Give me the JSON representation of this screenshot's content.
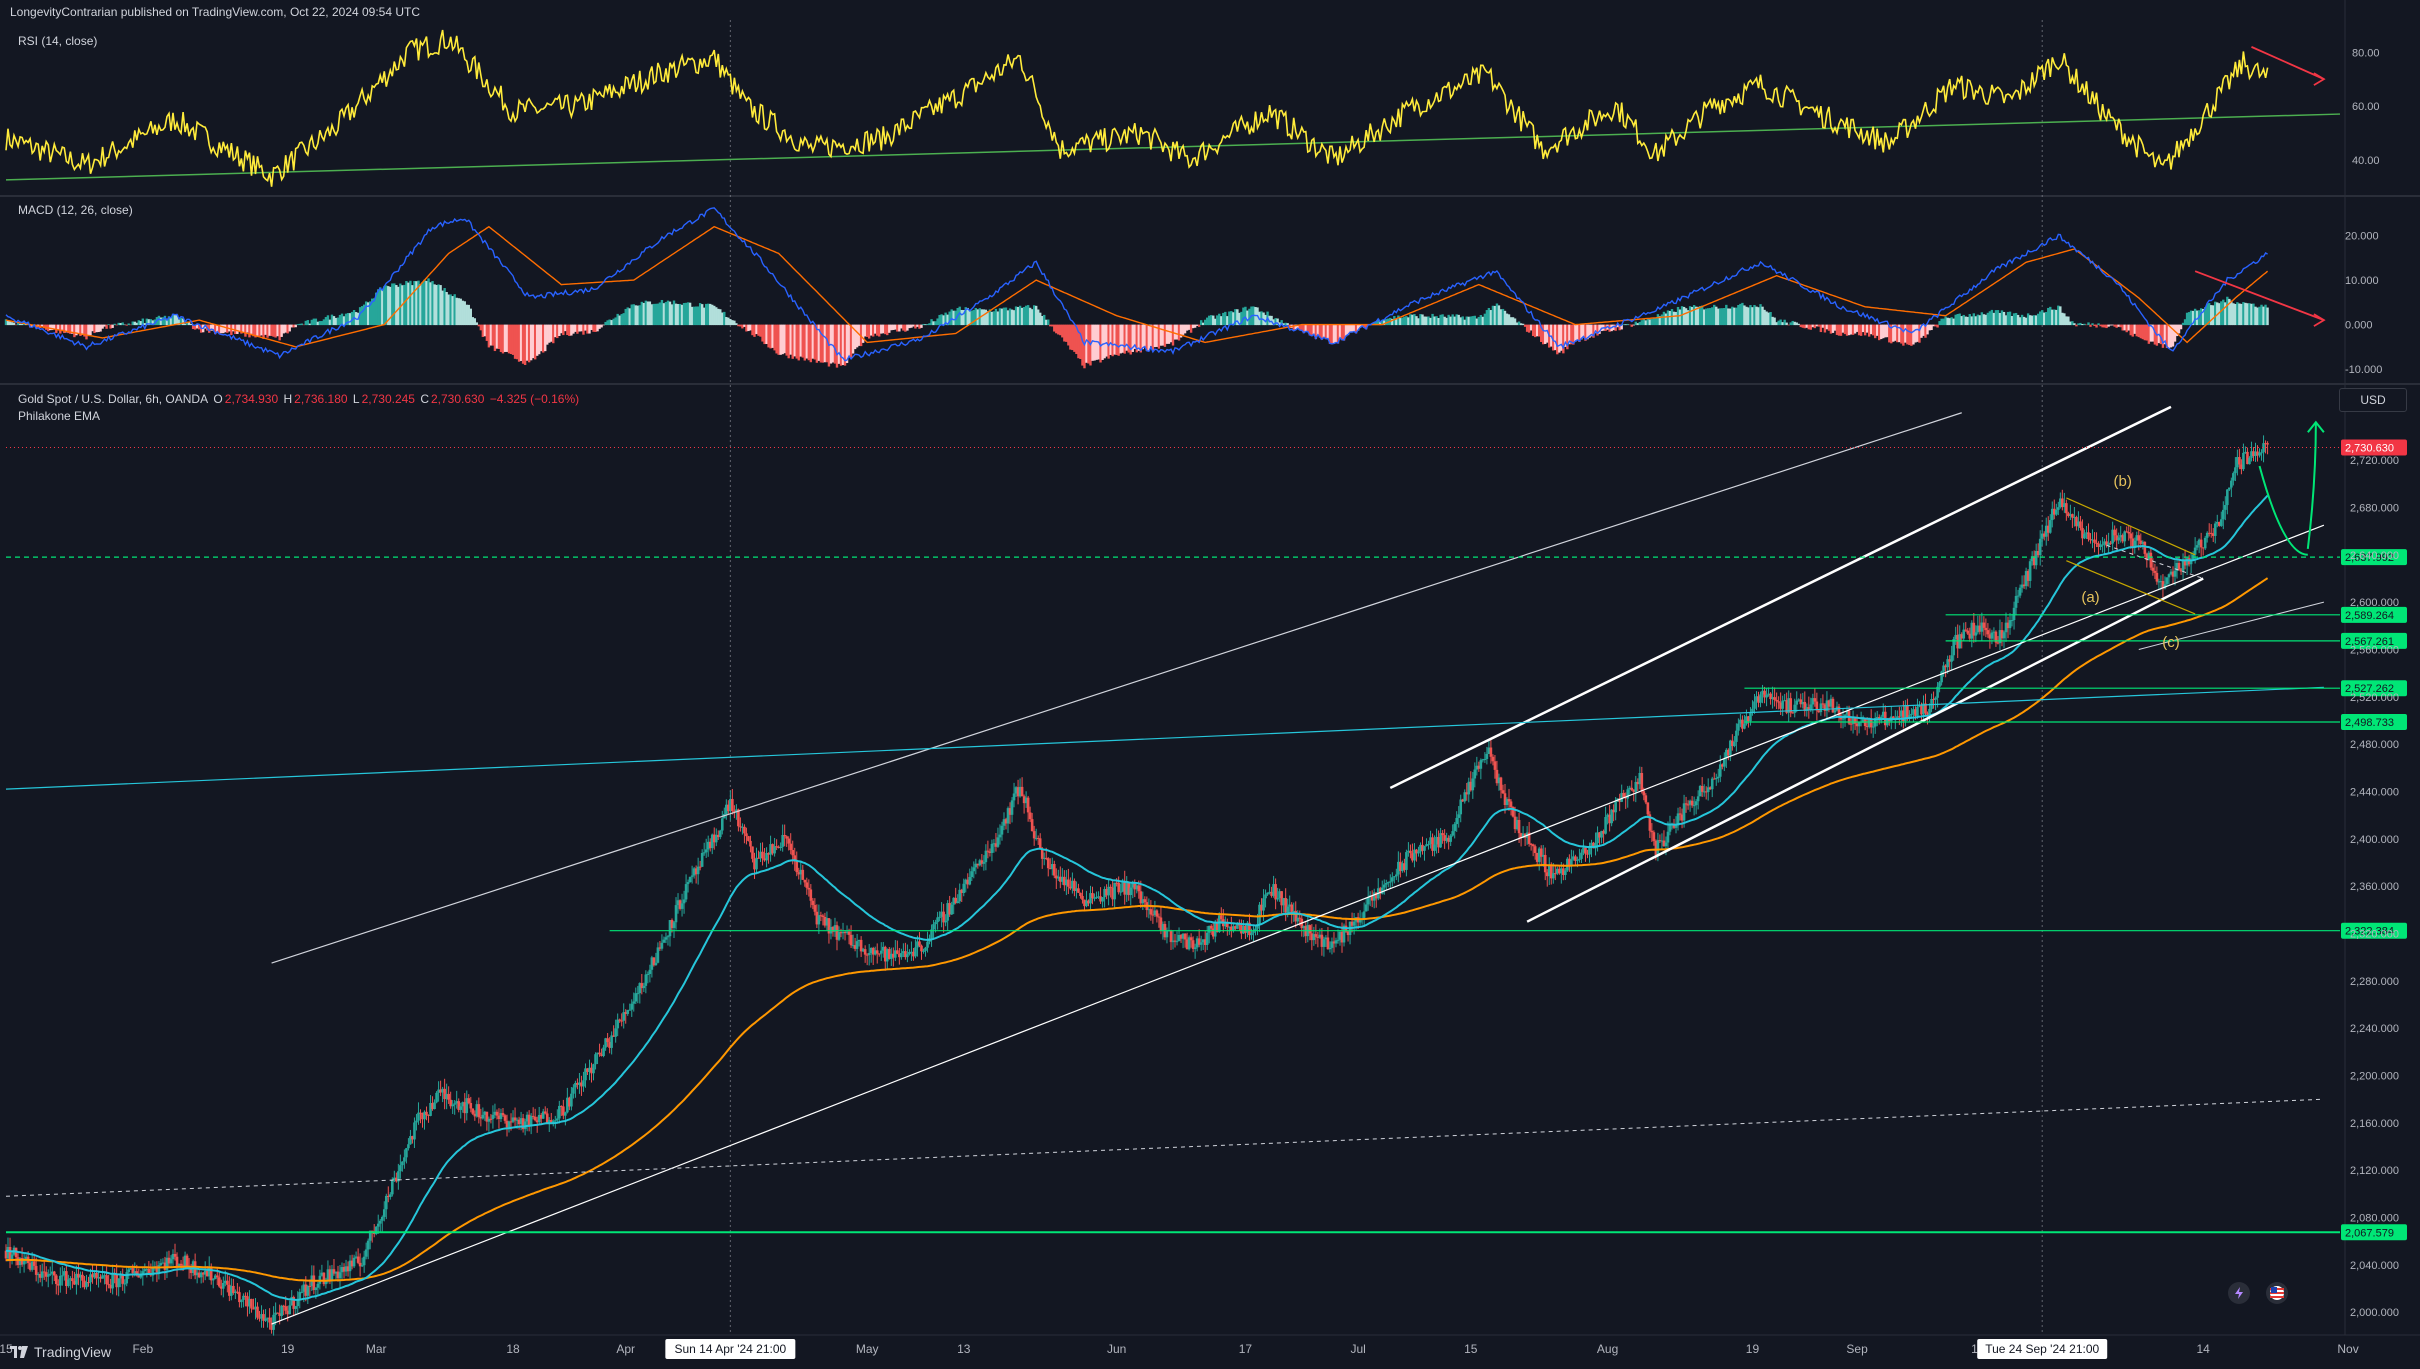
{
  "header": {
    "published": "LongevityContrarian published on TradingView.com, Oct 22, 2024 09:54 UTC"
  },
  "panes": {
    "rsi": {
      "title": "RSI (14, close)",
      "ticks": [
        "80.00",
        "60.00",
        "40.00"
      ]
    },
    "macd": {
      "title": "MACD (12, 26, close)",
      "ticks": [
        "20.000",
        "10.000",
        "0.000",
        "-10.000"
      ]
    },
    "price": {
      "symbol": "Gold Spot / U.S. Dollar, 6h, OANDA",
      "open_label": "O",
      "open": "2,734.930",
      "high_label": "H",
      "high": "2,736.180",
      "low_label": "L",
      "low": "2,730.245",
      "close_label": "C",
      "close": "2,730.630",
      "change": "−4.325 (−0.16%)",
      "indicator": "Philakone EMA",
      "currency": "USD"
    }
  },
  "footer": {
    "brand": "TradingView"
  },
  "icons": [
    "tradingview-logo-icon",
    "lightning-icon",
    "us-flag-icon"
  ],
  "colors": {
    "background": "#131722",
    "rsi_line": "#ffeb3b",
    "macd_line": "#2962ff",
    "signal_line": "#ff6d00",
    "ema_fast": "#26c6da",
    "ema_slow": "#ff9800",
    "support_green": "#00e676",
    "bull_candle": "#26a69a",
    "bear_candle": "#ef5350"
  },
  "chart_data": {
    "type": "candlestick",
    "title": "Gold Spot / U.S. Dollar, 6h, OANDA",
    "x_range": [
      "2024-01-15",
      "2024-10-31"
    ],
    "x_ticks": [
      "15",
      "Feb",
      "19",
      "Mar",
      "18",
      "Apr",
      "May",
      "13",
      "Jun",
      "17",
      "Jul",
      "15",
      "Aug",
      "19",
      "Sep",
      "16",
      "14",
      "Nov"
    ],
    "crosshair_labels": [
      "Sun 14 Apr '24   21:00",
      "Tue 24 Sep '24   21:00"
    ],
    "crosshair_x": [
      "2024-04-14",
      "2024-09-24"
    ],
    "y_range": [
      1985,
      2775
    ],
    "y_ticks": [
      2000,
      2040,
      2080,
      2120,
      2160,
      2200,
      2240,
      2280,
      2320,
      2360,
      2400,
      2440,
      2480,
      2520,
      2560,
      2600,
      2640,
      2680,
      2720
    ],
    "last_price": {
      "value": 2730.63,
      "label": "2,730.630"
    },
    "price_path": [
      [
        "2024-01-15",
        2052
      ],
      [
        "2024-01-20",
        2030
      ],
      [
        "2024-01-28",
        2025
      ],
      [
        "2024-02-05",
        2045
      ],
      [
        "2024-02-10",
        2030
      ],
      [
        "2024-02-17",
        1990
      ],
      [
        "2024-02-22",
        2025
      ],
      [
        "2024-02-28",
        2042
      ],
      [
        "2024-03-02",
        2090
      ],
      [
        "2024-03-06",
        2160
      ],
      [
        "2024-03-09",
        2185
      ],
      [
        "2024-03-15",
        2165
      ],
      [
        "2024-03-20",
        2160
      ],
      [
        "2024-03-24",
        2170
      ],
      [
        "2024-03-30",
        2230
      ],
      [
        "2024-04-04",
        2290
      ],
      [
        "2024-04-08",
        2350
      ],
      [
        "2024-04-12",
        2400
      ],
      [
        "2024-04-14",
        2432
      ],
      [
        "2024-04-17",
        2380
      ],
      [
        "2024-04-21",
        2400
      ],
      [
        "2024-04-25",
        2330
      ],
      [
        "2024-04-30",
        2310
      ],
      [
        "2024-05-04",
        2300
      ],
      [
        "2024-05-08",
        2310
      ],
      [
        "2024-05-13",
        2360
      ],
      [
        "2024-05-17",
        2400
      ],
      [
        "2024-05-20",
        2445
      ],
      [
        "2024-05-23",
        2380
      ],
      [
        "2024-05-28",
        2350
      ],
      [
        "2024-06-03",
        2360
      ],
      [
        "2024-06-07",
        2320
      ],
      [
        "2024-06-11",
        2310
      ],
      [
        "2024-06-14",
        2330
      ],
      [
        "2024-06-18",
        2325
      ],
      [
        "2024-06-20",
        2360
      ],
      [
        "2024-06-25",
        2320
      ],
      [
        "2024-06-28",
        2310
      ],
      [
        "2024-07-03",
        2350
      ],
      [
        "2024-07-08",
        2390
      ],
      [
        "2024-07-12",
        2400
      ],
      [
        "2024-07-16",
        2460
      ],
      [
        "2024-07-17",
        2475
      ],
      [
        "2024-07-20",
        2420
      ],
      [
        "2024-07-25",
        2370
      ],
      [
        "2024-07-30",
        2390
      ],
      [
        "2024-08-02",
        2430
      ],
      [
        "2024-08-05",
        2450
      ],
      [
        "2024-08-07",
        2390
      ],
      [
        "2024-08-10",
        2420
      ],
      [
        "2024-08-14",
        2450
      ],
      [
        "2024-08-18",
        2500
      ],
      [
        "2024-08-20",
        2525
      ],
      [
        "2024-08-24",
        2510
      ],
      [
        "2024-08-28",
        2515
      ],
      [
        "2024-09-02",
        2495
      ],
      [
        "2024-09-06",
        2505
      ],
      [
        "2024-09-10",
        2510
      ],
      [
        "2024-09-13",
        2565
      ],
      [
        "2024-09-16",
        2580
      ],
      [
        "2024-09-19",
        2570
      ],
      [
        "2024-09-22",
        2620
      ],
      [
        "2024-09-26",
        2685
      ],
      [
        "2024-09-30",
        2650
      ],
      [
        "2024-10-03",
        2655
      ],
      [
        "2024-10-06",
        2650
      ],
      [
        "2024-10-09",
        2615
      ],
      [
        "2024-10-11",
        2630
      ],
      [
        "2024-10-14",
        2650
      ],
      [
        "2024-10-16",
        2670
      ],
      [
        "2024-10-18",
        2715
      ],
      [
        "2024-10-21",
        2732
      ],
      [
        "2024-10-22",
        2730
      ]
    ],
    "series": [
      {
        "name": "Philakone EMA",
        "color": "#26c6da"
      },
      {
        "name": "Philakone EMA",
        "color": "#ff9800"
      }
    ],
    "horizontal_levels": [
      {
        "value": 2637.992,
        "label": "2,637.992",
        "style": "dashed"
      },
      {
        "value": 2589.264,
        "label": "2,589.264",
        "style": "solid"
      },
      {
        "value": 2567.261,
        "label": "2,567.261",
        "style": "solid"
      },
      {
        "value": 2527.262,
        "label": "2,527.262",
        "style": "solid"
      },
      {
        "value": 2498.733,
        "label": "2,498.733",
        "style": "solid"
      },
      {
        "value": 2322.384,
        "label": "2,322.384",
        "style": "solid"
      },
      {
        "value": 2067.579,
        "label": "2,067.579",
        "style": "solid"
      }
    ],
    "wave_labels": [
      "(a)",
      "(b)",
      "(c)"
    ],
    "rsi": {
      "y_range": [
        28,
        92
      ],
      "ticks": [
        80,
        60,
        40
      ],
      "path": [
        [
          "2024-01-15",
          48
        ],
        [
          "2024-01-25",
          38
        ],
        [
          "2024-02-05",
          55
        ],
        [
          "2024-02-17",
          34
        ],
        [
          "2024-02-25",
          52
        ],
        [
          "2024-03-05",
          80
        ],
        [
          "2024-03-10",
          85
        ],
        [
          "2024-03-18",
          58
        ],
        [
          "2024-03-26",
          60
        ],
        [
          "2024-04-05",
          72
        ],
        [
          "2024-04-12",
          78
        ],
        [
          "2024-04-16",
          60
        ],
        [
          "2024-04-24",
          44
        ],
        [
          "2024-05-03",
          48
        ],
        [
          "2024-05-13",
          65
        ],
        [
          "2024-05-20",
          78
        ],
        [
          "2024-05-25",
          44
        ],
        [
          "2024-06-04",
          50
        ],
        [
          "2024-06-10",
          40
        ],
        [
          "2024-06-20",
          58
        ],
        [
          "2024-06-28",
          40
        ],
        [
          "2024-07-08",
          60
        ],
        [
          "2024-07-17",
          72
        ],
        [
          "2024-07-24",
          44
        ],
        [
          "2024-08-02",
          60
        ],
        [
          "2024-08-07",
          42
        ],
        [
          "2024-08-14",
          60
        ],
        [
          "2024-08-20",
          68
        ],
        [
          "2024-08-28",
          56
        ],
        [
          "2024-09-05",
          46
        ],
        [
          "2024-09-13",
          68
        ],
        [
          "2024-09-20",
          62
        ],
        [
          "2024-09-26",
          78
        ],
        [
          "2024-10-02",
          56
        ],
        [
          "2024-10-09",
          36
        ],
        [
          "2024-10-15",
          60
        ],
        [
          "2024-10-19",
          76
        ],
        [
          "2024-10-22",
          70
        ]
      ]
    },
    "macd": {
      "y_range": [
        -12,
        28
      ],
      "ticks": [
        20,
        10,
        0,
        -10
      ],
      "macd_path": [
        [
          "2024-01-15",
          2
        ],
        [
          "2024-01-25",
          -5
        ],
        [
          "2024-02-05",
          2
        ],
        [
          "2024-02-18",
          -7
        ],
        [
          "2024-02-28",
          2
        ],
        [
          "2024-03-08",
          22
        ],
        [
          "2024-03-12",
          24
        ],
        [
          "2024-03-20",
          6
        ],
        [
          "2024-03-28",
          8
        ],
        [
          "2024-04-06",
          20
        ],
        [
          "2024-04-12",
          26
        ],
        [
          "2024-04-18",
          14
        ],
        [
          "2024-04-28",
          -8
        ],
        [
          "2024-05-08",
          -3
        ],
        [
          "2024-05-16",
          6
        ],
        [
          "2024-05-22",
          14
        ],
        [
          "2024-05-28",
          -4
        ],
        [
          "2024-06-08",
          -6
        ],
        [
          "2024-06-18",
          2
        ],
        [
          "2024-06-28",
          -4
        ],
        [
          "2024-07-08",
          5
        ],
        [
          "2024-07-18",
          12
        ],
        [
          "2024-07-26",
          -5
        ],
        [
          "2024-08-08",
          4
        ],
        [
          "2024-08-20",
          14
        ],
        [
          "2024-08-30",
          4
        ],
        [
          "2024-09-08",
          -2
        ],
        [
          "2024-09-18",
          12
        ],
        [
          "2024-09-26",
          20
        ],
        [
          "2024-10-03",
          10
        ],
        [
          "2024-10-10",
          -6
        ],
        [
          "2024-10-17",
          10
        ],
        [
          "2024-10-22",
          16
        ]
      ],
      "signal_path": [
        [
          "2024-01-15",
          1
        ],
        [
          "2024-01-27",
          -3
        ],
        [
          "2024-02-08",
          1
        ],
        [
          "2024-02-20",
          -5
        ],
        [
          "2024-03-02",
          0
        ],
        [
          "2024-03-10",
          16
        ],
        [
          "2024-03-15",
          22
        ],
        [
          "2024-03-24",
          9
        ],
        [
          "2024-04-02",
          10
        ],
        [
          "2024-04-12",
          22
        ],
        [
          "2024-04-20",
          16
        ],
        [
          "2024-05-01",
          -4
        ],
        [
          "2024-05-12",
          -2
        ],
        [
          "2024-05-22",
          10
        ],
        [
          "2024-06-01",
          2
        ],
        [
          "2024-06-12",
          -4
        ],
        [
          "2024-06-24",
          0
        ],
        [
          "2024-07-04",
          0
        ],
        [
          "2024-07-16",
          9
        ],
        [
          "2024-07-28",
          0
        ],
        [
          "2024-08-10",
          2
        ],
        [
          "2024-08-22",
          11
        ],
        [
          "2024-09-02",
          4
        ],
        [
          "2024-09-12",
          2
        ],
        [
          "2024-09-22",
          14
        ],
        [
          "2024-09-28",
          17
        ],
        [
          "2024-10-06",
          6
        ],
        [
          "2024-10-12",
          -4
        ],
        [
          "2024-10-18",
          6
        ],
        [
          "2024-10-22",
          12
        ]
      ]
    }
  }
}
